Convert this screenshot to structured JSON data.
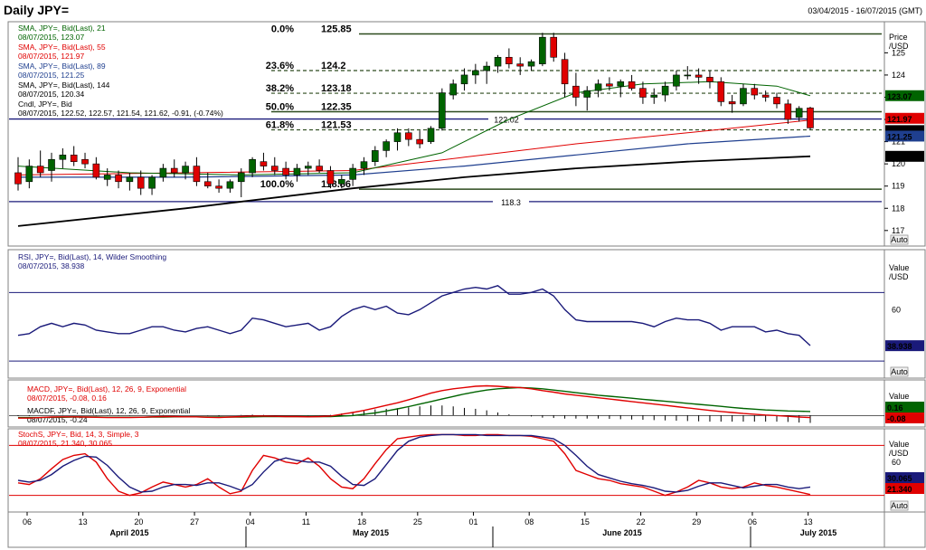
{
  "header": {
    "title": "Daily JPY=",
    "date_range": "03/04/2015 - 16/07/2015 (GMT)"
  },
  "price_panel": {
    "axis_title": "Price",
    "axis_unit": "/USD",
    "auto_label": "Auto",
    "legend": [
      {
        "line1": "SMA, JPY=, Bid(Last), 21",
        "line2": "08/07/2015, 123.07",
        "color": "#006400"
      },
      {
        "line1": "SMA, JPY=, Bid(Last), 55",
        "line2": "08/07/2015, 121.97",
        "color": "#e00000"
      },
      {
        "line1": "SMA, JPY=, Bid(Last), 89",
        "line2": "08/07/2015, 121.25",
        "color": "#1f3f8f"
      },
      {
        "line1": "SMA, JPY=, Bid(Last), 144",
        "line2": "08/07/2015, 120.34",
        "color": "#000000"
      },
      {
        "line1": "Cndl, JPY=, Bid",
        "line2": "08/07/2015, 122.52, 122.57, 121.54, 121.62, -0.91, (-0.74%)",
        "color": "#000000"
      }
    ],
    "ticks": [
      117,
      118,
      119,
      120,
      121,
      122,
      123,
      124,
      125
    ],
    "ylim": [
      116.3,
      126.4
    ],
    "fib_levels": [
      {
        "pct": "0.0%",
        "value": "125.85",
        "v": 125.85,
        "style": "solid",
        "color": "#3a5a2a"
      },
      {
        "pct": "23.6%",
        "value": "124.2",
        "v": 124.2,
        "style": "dashed",
        "color": "#3a5a2a"
      },
      {
        "pct": "38.2%",
        "value": "123.18",
        "v": 123.18,
        "style": "dashed",
        "color": "#3a5a2a"
      },
      {
        "pct": "50.0%",
        "value": "122.35",
        "v": 122.35,
        "style": "solid",
        "color": "#3a5a2a"
      },
      {
        "pct": "61.8%",
        "value": "121.53",
        "v": 121.53,
        "style": "dashed",
        "color": "#3a5a2a"
      },
      {
        "pct": "100.0%",
        "value": "118.86",
        "v": 118.86,
        "style": "solid",
        "color": "#3a5a2a"
      }
    ],
    "hlines": [
      {
        "label": "122.02",
        "v": 122.02,
        "color": "#1a1a7a"
      },
      {
        "label": "118.3",
        "v": 118.3,
        "color": "#1a1a7a"
      }
    ],
    "value_tags": [
      {
        "text": "123.07",
        "v": 123.07,
        "bg": "#006400",
        "fg": "#ffffff"
      },
      {
        "text": "121.97",
        "v": 121.97,
        "bg": "#e00000",
        "fg": "#ffffff"
      },
      {
        "text": "121.62",
        "v": 121.62,
        "bg": "#000000",
        "fg": "#ffffff"
      },
      {
        "text": "121.25",
        "v": 121.25,
        "bg": "#1f3f8f",
        "fg": "#ffffff"
      },
      {
        "text": "120.34",
        "v": 120.34,
        "bg": "#000000",
        "fg": "#ffffff"
      }
    ]
  },
  "rsi_panel": {
    "legend_line1": "RSI, JPY=, Bid(Last), 14, Wilder Smoothing",
    "legend_line2": "08/07/2015, 38.938",
    "axis_title": "Value",
    "axis_unit": "/USD",
    "auto_label": "Auto",
    "ticks": [
      60,
      40
    ],
    "ylim": [
      20,
      95
    ],
    "bands": [
      70,
      30
    ],
    "tag": "38.938",
    "tag_v": 38.938
  },
  "macd_panel": {
    "legend": [
      {
        "line1": "MACD, JPY=, Bid(Last),  12, 26, 9, Exponential",
        "line2": "08/07/2015, -0.08, 0.16",
        "color": "#e00000"
      },
      {
        "line1": "MACDF, JPY=, Bid(Last),  12, 26, 9, Exponential",
        "line2": "08/07/2015, -0.24",
        "color": "#000000"
      }
    ],
    "axis_title": "Value",
    "axis_unit": "/USD",
    "auto_label": "Auto",
    "ylim": [
      -0.45,
      1.4
    ],
    "tags": [
      {
        "text": "0.16",
        "v": 0.16,
        "bg": "#006400",
        "fg": "#ffffff"
      },
      {
        "text": "-0.08",
        "v": -0.08,
        "bg": "#e00000",
        "fg": "#ffffff"
      }
    ]
  },
  "stoch_panel": {
    "legend_line1": "StochS, JPY=, Bid,  14, 3, Simple, 3",
    "legend_line2": "08/07/2015, 21.340, 30.065",
    "axis_title": "Value",
    "axis_unit": "/USD",
    "auto_label": "Auto",
    "ticks": [
      60
    ],
    "ylim": [
      0,
      100
    ],
    "bands": [
      80,
      20
    ],
    "tags": [
      {
        "text": "30.065",
        "v": 30.065,
        "bg": "#1a1a7a",
        "fg": "#ffffff"
      },
      {
        "text": "21.340",
        "v": 21.34,
        "bg": "#e00000",
        "fg": "#ffffff"
      }
    ]
  },
  "x_axis": {
    "day_ticks": [
      "06",
      "13",
      "20",
      "27",
      "04",
      "11",
      "18",
      "25",
      "01",
      "08",
      "15",
      "22",
      "29",
      "06",
      "13"
    ],
    "months": [
      "April 2015",
      "May 2015",
      "June 2015",
      "July 2015"
    ]
  },
  "chart_data": {
    "type": "candlestick",
    "title": "Daily JPY=",
    "candles": [
      {
        "o": 119.6,
        "h": 120.3,
        "l": 118.8,
        "c": 119.1
      },
      {
        "o": 119.2,
        "h": 120.2,
        "l": 118.9,
        "c": 119.9
      },
      {
        "o": 119.9,
        "h": 120.6,
        "l": 119.4,
        "c": 119.6
      },
      {
        "o": 119.7,
        "h": 120.5,
        "l": 119.2,
        "c": 120.2
      },
      {
        "o": 120.2,
        "h": 120.7,
        "l": 119.8,
        "c": 120.4
      },
      {
        "o": 120.4,
        "h": 120.8,
        "l": 119.9,
        "c": 120.1
      },
      {
        "o": 120.2,
        "h": 120.5,
        "l": 119.8,
        "c": 120.0
      },
      {
        "o": 120.0,
        "h": 120.3,
        "l": 119.3,
        "c": 119.4
      },
      {
        "o": 119.3,
        "h": 119.8,
        "l": 119.0,
        "c": 119.5
      },
      {
        "o": 119.5,
        "h": 119.7,
        "l": 118.9,
        "c": 119.2
      },
      {
        "o": 119.2,
        "h": 119.6,
        "l": 118.8,
        "c": 119.4
      },
      {
        "o": 119.4,
        "h": 119.7,
        "l": 118.6,
        "c": 118.9
      },
      {
        "o": 118.9,
        "h": 119.5,
        "l": 118.6,
        "c": 119.4
      },
      {
        "o": 119.4,
        "h": 120.0,
        "l": 119.2,
        "c": 119.8
      },
      {
        "o": 119.8,
        "h": 120.2,
        "l": 119.4,
        "c": 119.6
      },
      {
        "o": 119.6,
        "h": 120.1,
        "l": 119.3,
        "c": 119.9
      },
      {
        "o": 119.9,
        "h": 120.3,
        "l": 119.0,
        "c": 119.2
      },
      {
        "o": 119.2,
        "h": 119.6,
        "l": 118.9,
        "c": 119.0
      },
      {
        "o": 119.0,
        "h": 119.3,
        "l": 118.7,
        "c": 118.9
      },
      {
        "o": 118.9,
        "h": 119.3,
        "l": 118.7,
        "c": 119.2
      },
      {
        "o": 119.2,
        "h": 119.8,
        "l": 118.5,
        "c": 119.6
      },
      {
        "o": 119.6,
        "h": 120.3,
        "l": 119.4,
        "c": 120.2
      },
      {
        "o": 120.1,
        "h": 120.5,
        "l": 119.7,
        "c": 119.9
      },
      {
        "o": 119.9,
        "h": 120.3,
        "l": 119.5,
        "c": 119.7
      },
      {
        "o": 119.8,
        "h": 120.1,
        "l": 119.3,
        "c": 119.5
      },
      {
        "o": 119.5,
        "h": 120.0,
        "l": 119.2,
        "c": 119.8
      },
      {
        "o": 119.8,
        "h": 120.1,
        "l": 119.5,
        "c": 119.9
      },
      {
        "o": 119.9,
        "h": 120.2,
        "l": 119.6,
        "c": 119.7
      },
      {
        "o": 119.7,
        "h": 119.9,
        "l": 118.9,
        "c": 119.1
      },
      {
        "o": 119.1,
        "h": 119.5,
        "l": 118.9,
        "c": 119.3
      },
      {
        "o": 119.3,
        "h": 120.0,
        "l": 119.0,
        "c": 119.8
      },
      {
        "o": 119.8,
        "h": 120.3,
        "l": 119.5,
        "c": 120.1
      },
      {
        "o": 120.1,
        "h": 120.8,
        "l": 119.9,
        "c": 120.6
      },
      {
        "o": 120.6,
        "h": 121.1,
        "l": 120.3,
        "c": 121.0
      },
      {
        "o": 121.0,
        "h": 121.6,
        "l": 120.6,
        "c": 121.4
      },
      {
        "o": 121.4,
        "h": 121.6,
        "l": 120.8,
        "c": 121.1
      },
      {
        "o": 121.1,
        "h": 121.5,
        "l": 120.7,
        "c": 120.9
      },
      {
        "o": 121.0,
        "h": 121.7,
        "l": 120.9,
        "c": 121.6
      },
      {
        "o": 121.6,
        "h": 123.4,
        "l": 121.5,
        "c": 123.2
      },
      {
        "o": 123.1,
        "h": 123.8,
        "l": 122.9,
        "c": 123.6
      },
      {
        "o": 123.6,
        "h": 124.3,
        "l": 123.3,
        "c": 124.0
      },
      {
        "o": 124.0,
        "h": 124.5,
        "l": 123.6,
        "c": 124.2
      },
      {
        "o": 124.2,
        "h": 124.6,
        "l": 123.6,
        "c": 124.4
      },
      {
        "o": 124.4,
        "h": 124.9,
        "l": 124.1,
        "c": 124.8
      },
      {
        "o": 124.8,
        "h": 125.2,
        "l": 124.3,
        "c": 124.5
      },
      {
        "o": 124.5,
        "h": 124.8,
        "l": 124.0,
        "c": 124.4
      },
      {
        "o": 124.4,
        "h": 124.7,
        "l": 124.2,
        "c": 124.6
      },
      {
        "o": 124.5,
        "h": 125.9,
        "l": 124.4,
        "c": 125.7
      },
      {
        "o": 125.7,
        "h": 125.9,
        "l": 124.6,
        "c": 124.8
      },
      {
        "o": 124.7,
        "h": 125.0,
        "l": 123.0,
        "c": 123.6
      },
      {
        "o": 123.5,
        "h": 124.1,
        "l": 122.6,
        "c": 123.0
      },
      {
        "o": 123.0,
        "h": 123.5,
        "l": 122.4,
        "c": 123.3
      },
      {
        "o": 123.3,
        "h": 123.8,
        "l": 123.0,
        "c": 123.6
      },
      {
        "o": 123.6,
        "h": 123.9,
        "l": 123.3,
        "c": 123.5
      },
      {
        "o": 123.5,
        "h": 123.8,
        "l": 123.0,
        "c": 123.7
      },
      {
        "o": 123.7,
        "h": 124.0,
        "l": 123.3,
        "c": 123.4
      },
      {
        "o": 123.4,
        "h": 123.7,
        "l": 122.7,
        "c": 123.0
      },
      {
        "o": 123.0,
        "h": 123.4,
        "l": 122.7,
        "c": 123.1
      },
      {
        "o": 123.1,
        "h": 123.7,
        "l": 122.8,
        "c": 123.5
      },
      {
        "o": 123.5,
        "h": 124.2,
        "l": 123.3,
        "c": 124.0
      },
      {
        "o": 124.0,
        "h": 124.4,
        "l": 123.8,
        "c": 124.0
      },
      {
        "o": 124.0,
        "h": 124.3,
        "l": 123.6,
        "c": 123.9
      },
      {
        "o": 123.9,
        "h": 124.2,
        "l": 123.4,
        "c": 123.7
      },
      {
        "o": 123.7,
        "h": 123.9,
        "l": 122.6,
        "c": 122.8
      },
      {
        "o": 122.8,
        "h": 123.1,
        "l": 122.3,
        "c": 122.7
      },
      {
        "o": 122.7,
        "h": 123.6,
        "l": 122.6,
        "c": 123.4
      },
      {
        "o": 123.4,
        "h": 123.6,
        "l": 122.9,
        "c": 123.1
      },
      {
        "o": 123.1,
        "h": 123.3,
        "l": 122.8,
        "c": 123.0
      },
      {
        "o": 123.0,
        "h": 123.2,
        "l": 122.5,
        "c": 122.7
      },
      {
        "o": 122.7,
        "h": 122.9,
        "l": 121.8,
        "c": 122.0
      },
      {
        "o": 122.1,
        "h": 122.6,
        "l": 121.9,
        "c": 122.5
      },
      {
        "o": 122.52,
        "h": 122.57,
        "l": 121.54,
        "c": 121.62
      }
    ],
    "sma21_points": [
      [
        0,
        119.9
      ],
      [
        10,
        119.6
      ],
      [
        20,
        119.5
      ],
      [
        30,
        119.6
      ],
      [
        38,
        120.5
      ],
      [
        44,
        122.0
      ],
      [
        50,
        123.2
      ],
      [
        56,
        123.6
      ],
      [
        62,
        123.7
      ],
      [
        68,
        123.5
      ],
      [
        71,
        123.07
      ]
    ],
    "sma55_points": [
      [
        0,
        119.5
      ],
      [
        15,
        119.6
      ],
      [
        30,
        119.7
      ],
      [
        40,
        120.3
      ],
      [
        50,
        120.9
      ],
      [
        60,
        121.4
      ],
      [
        71,
        121.97
      ]
    ],
    "sma89_points": [
      [
        0,
        119.4
      ],
      [
        15,
        119.4
      ],
      [
        30,
        119.5
      ],
      [
        40,
        119.9
      ],
      [
        50,
        120.4
      ],
      [
        60,
        120.9
      ],
      [
        71,
        121.25
      ]
    ],
    "sma144_points": [
      [
        0,
        117.2
      ],
      [
        15,
        118.0
      ],
      [
        30,
        118.9
      ],
      [
        40,
        119.4
      ],
      [
        50,
        119.8
      ],
      [
        60,
        120.1
      ],
      [
        71,
        120.34
      ]
    ],
    "rsi_values": [
      45,
      46,
      50,
      52,
      50,
      52,
      51,
      48,
      47,
      46,
      46,
      48,
      50,
      50,
      48,
      47,
      49,
      50,
      48,
      46,
      48,
      55,
      54,
      52,
      50,
      51,
      52,
      48,
      50,
      56,
      60,
      62,
      60,
      62,
      58,
      57,
      60,
      64,
      68,
      70,
      72,
      73,
      72,
      74,
      69,
      69,
      70,
      72,
      68,
      60,
      54,
      53,
      53,
      53,
      53,
      53,
      52,
      50,
      53,
      55,
      54,
      54,
      52,
      48,
      50,
      50,
      50,
      47,
      48,
      46,
      45,
      39
    ],
    "macd_line": [
      -0.1,
      -0.1,
      -0.08,
      -0.06,
      -0.05,
      -0.05,
      -0.06,
      -0.07,
      -0.08,
      -0.08,
      -0.08,
      -0.07,
      -0.05,
      -0.04,
      -0.04,
      -0.05,
      -0.05,
      -0.07,
      -0.08,
      -0.06,
      -0.04,
      -0.02,
      -0.02,
      -0.03,
      -0.04,
      -0.04,
      -0.05,
      -0.04,
      -0.02,
      0.05,
      0.12,
      0.2,
      0.3,
      0.4,
      0.5,
      0.62,
      0.75,
      0.88,
      0.98,
      1.05,
      1.1,
      1.15,
      1.17,
      1.15,
      1.12,
      1.1,
      1.05,
      0.98,
      0.92,
      0.85,
      0.8,
      0.75,
      0.7,
      0.65,
      0.6,
      0.55,
      0.5,
      0.45,
      0.4,
      0.35,
      0.3,
      0.25,
      0.2,
      0.16,
      0.12,
      0.08,
      0.05,
      0.02,
      0.0,
      -0.03,
      -0.06,
      -0.08
    ],
    "macd_signal": [
      -0.08,
      -0.08,
      -0.08,
      -0.07,
      -0.07,
      -0.06,
      -0.06,
      -0.06,
      -0.07,
      -0.07,
      -0.07,
      -0.07,
      -0.06,
      -0.06,
      -0.05,
      -0.05,
      -0.05,
      -0.06,
      -0.06,
      -0.06,
      -0.06,
      -0.05,
      -0.04,
      -0.04,
      -0.04,
      -0.04,
      -0.04,
      -0.04,
      -0.04,
      -0.02,
      0.0,
      0.05,
      0.1,
      0.18,
      0.26,
      0.35,
      0.45,
      0.55,
      0.65,
      0.75,
      0.85,
      0.93,
      1.0,
      1.05,
      1.08,
      1.1,
      1.08,
      1.05,
      1.0,
      0.95,
      0.9,
      0.85,
      0.8,
      0.76,
      0.72,
      0.68,
      0.64,
      0.6,
      0.56,
      0.52,
      0.48,
      0.44,
      0.4,
      0.36,
      0.32,
      0.28,
      0.25,
      0.22,
      0.2,
      0.18,
      0.17,
      0.16
    ],
    "stoch_k": [
      35,
      33,
      40,
      52,
      63,
      68,
      70,
      60,
      40,
      25,
      20,
      23,
      30,
      36,
      33,
      30,
      33,
      40,
      30,
      22,
      25,
      50,
      68,
      65,
      60,
      58,
      65,
      55,
      40,
      30,
      28,
      40,
      58,
      75,
      88,
      90,
      92,
      93,
      93,
      93,
      92,
      92,
      93,
      93,
      92,
      92,
      91,
      88,
      85,
      70,
      50,
      45,
      40,
      38,
      34,
      32,
      30,
      25,
      20,
      24,
      30,
      38,
      35,
      30,
      28,
      30,
      35,
      32,
      30,
      27,
      24,
      21
    ],
    "stoch_d": [
      38,
      36,
      38,
      45,
      55,
      62,
      67,
      66,
      56,
      42,
      30,
      24,
      25,
      30,
      33,
      33,
      32,
      35,
      35,
      31,
      26,
      33,
      48,
      61,
      65,
      62,
      60,
      60,
      55,
      43,
      33,
      32,
      40,
      57,
      74,
      85,
      90,
      92,
      93,
      93,
      93,
      93,
      92,
      92,
      92,
      92,
      92,
      90,
      88,
      80,
      68,
      55,
      45,
      41,
      37,
      34,
      32,
      29,
      25,
      24,
      26,
      31,
      35,
      35,
      32,
      29,
      31,
      33,
      33,
      30,
      28,
      30
    ]
  }
}
